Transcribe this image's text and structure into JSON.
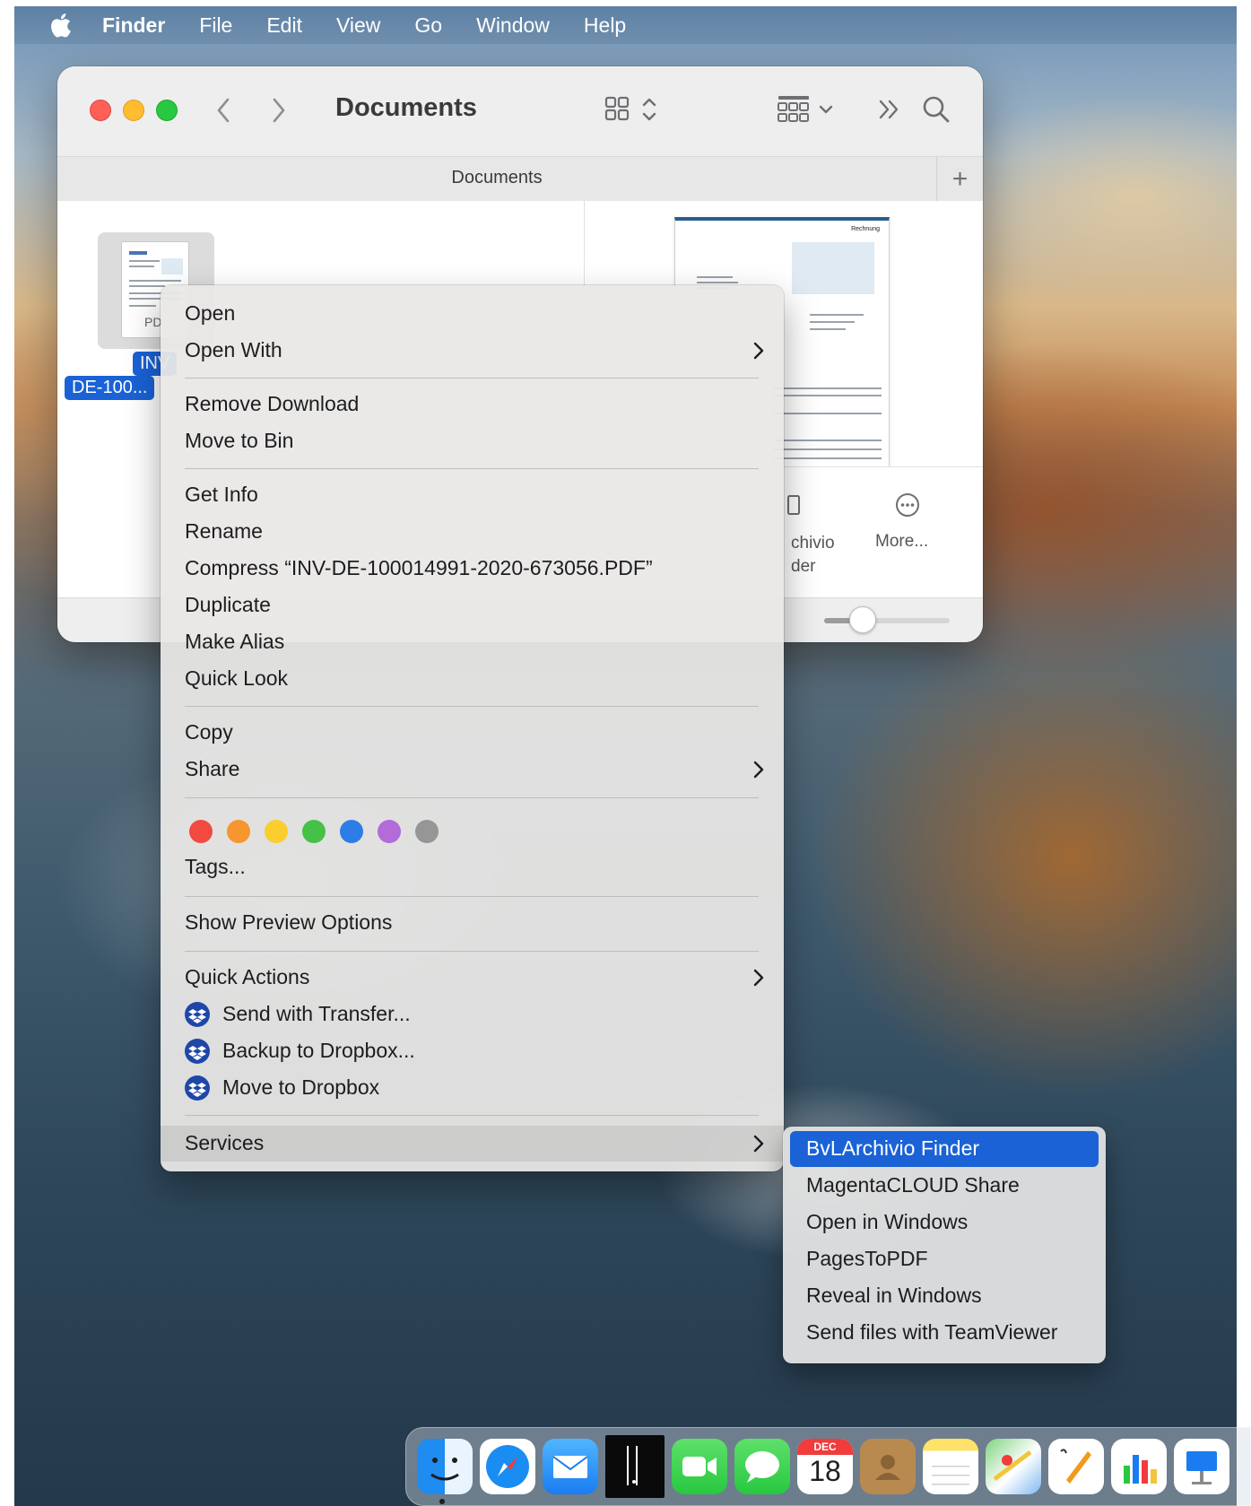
{
  "menubar": {
    "apple_icon": "apple-logo-icon",
    "items": [
      "Finder",
      "File",
      "Edit",
      "View",
      "Go",
      "Window",
      "Help"
    ]
  },
  "finder": {
    "title": "Documents",
    "tab_label": "Documents",
    "tab_add": "+",
    "selected_file": {
      "icon_type_label": "PD",
      "name_line1": "INV",
      "name_line2": "DE-100..."
    },
    "preview": {
      "heading": "Rechnung"
    },
    "preview_actions": {
      "archivio_label_line1": "chivio",
      "archivio_label_line2": "der",
      "more_label": "More..."
    },
    "zoom_level": 0.2
  },
  "context_menu": {
    "open": "Open",
    "open_with": "Open With",
    "remove_download": "Remove Download",
    "move_to_bin": "Move to Bin",
    "get_info": "Get Info",
    "rename": "Rename",
    "compress": "Compress “INV-DE-100014991-2020-673056.PDF”",
    "duplicate": "Duplicate",
    "make_alias": "Make Alias",
    "quick_look": "Quick Look",
    "copy": "Copy",
    "share": "Share",
    "tag_colors": [
      "#f04a41",
      "#f6962e",
      "#f9ce2d",
      "#46c147",
      "#2d7de8",
      "#b26bd9",
      "#969696"
    ],
    "tags": "Tags...",
    "show_preview_options": "Show Preview Options",
    "quick_actions": "Quick Actions",
    "send_with_transfer": "Send with Transfer...",
    "backup_to_dropbox": "Backup to Dropbox...",
    "move_to_dropbox": "Move to Dropbox",
    "services": "Services"
  },
  "services_menu": {
    "items": [
      "BvLArchivio Finder",
      "MagentaCLOUD Share",
      "Open in Windows",
      "PagesToPDF",
      "Reveal in Windows",
      "Send files with TeamViewer"
    ]
  },
  "dock": {
    "calendar_month": "DEC",
    "calendar_day": "18"
  }
}
